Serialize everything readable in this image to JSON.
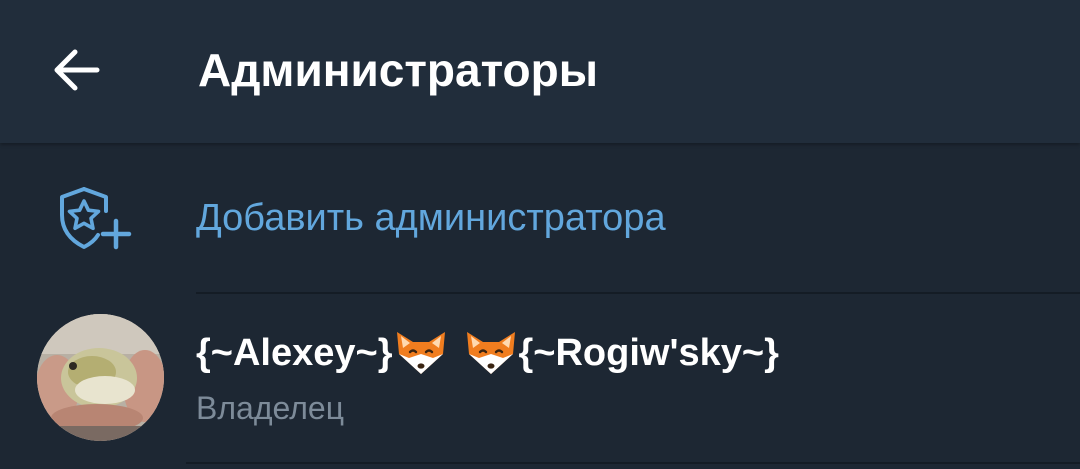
{
  "header": {
    "title": "Администраторы",
    "back_icon": "arrow-left-icon"
  },
  "add_admin": {
    "label": "Добавить администратора",
    "icon": "shield-star-plus-icon"
  },
  "admins": [
    {
      "name_part1": "{~Alexey~}",
      "emoji1": "fox-face-icon",
      "emoji2": "fox-face-icon",
      "name_part2": "{~Rogiw'sky~}",
      "role": "Владелец",
      "avatar": "pufferfish-photo-avatar"
    }
  ],
  "colors": {
    "header_bg": "#212d3b",
    "page_bg": "#1d2733",
    "accent": "#62a7dd",
    "secondary_text": "#7d8b99"
  }
}
